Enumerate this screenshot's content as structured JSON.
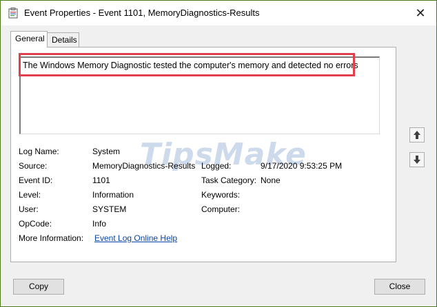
{
  "window": {
    "title": "Event Properties - Event 1101, MemoryDiagnostics-Results",
    "close_glyph": "✕"
  },
  "tabs": [
    {
      "label": "General",
      "active": true
    },
    {
      "label": "Details",
      "active": false
    }
  ],
  "description": "The Windows Memory Diagnostic tested the computer's memory and detected no errors",
  "watermark": "TipsMake",
  "fields": {
    "log_name_label": "Log Name:",
    "log_name_value": "System",
    "source_label": "Source:",
    "source_value": "MemoryDiagnostics-Results",
    "logged_label": "Logged:",
    "logged_value": "9/17/2020 9:53:25 PM",
    "event_id_label": "Event ID:",
    "event_id_value": "1101",
    "task_category_label": "Task Category:",
    "task_category_value": "None",
    "level_label": "Level:",
    "level_value": "Information",
    "keywords_label": "Keywords:",
    "user_label": "User:",
    "user_value": "SYSTEM",
    "computer_label": "Computer:",
    "opcode_label": "OpCode:",
    "opcode_value": "Info",
    "more_info_label": "More Information:",
    "more_info_link": "Event Log Online Help"
  },
  "buttons": {
    "copy": "Copy",
    "close": "Close"
  },
  "icons": {
    "app": "event-viewer-icon",
    "up": "arrow-up-icon",
    "down": "arrow-down-icon"
  },
  "colors": {
    "window_border": "#4a7a18",
    "highlight": "#e0404a",
    "link": "#0645ad"
  }
}
